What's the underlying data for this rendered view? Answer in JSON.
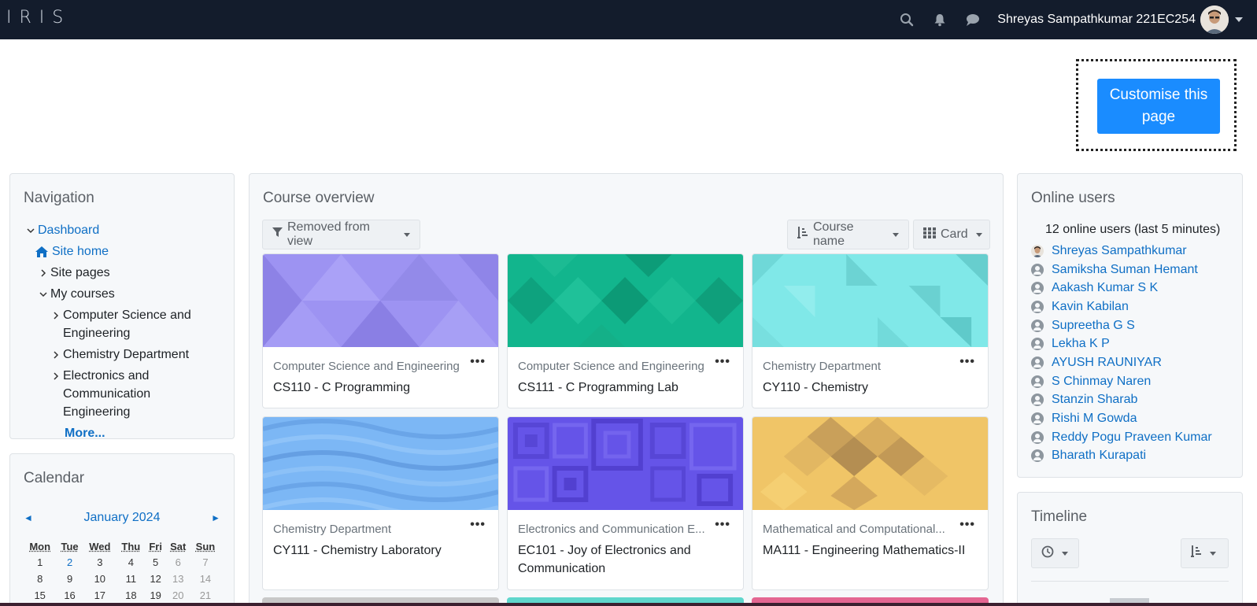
{
  "navbar": {
    "logo": "IRIS",
    "username": "Shreyas Sampathkumar 221EC254",
    "icons": [
      "search-icon",
      "bell-icon",
      "chat-icon"
    ]
  },
  "customise": {
    "label": "Customise this page"
  },
  "navigation": {
    "title": "Navigation",
    "dashboard": "Dashboard",
    "site_home": "Site home",
    "site_pages": "Site pages",
    "my_courses": "My courses",
    "courses": [
      "Computer Science and Engineering",
      "Chemistry Department",
      "Electronics and Communication Engineering"
    ],
    "more": "More..."
  },
  "calendar": {
    "title": "Calendar",
    "prev": "◄",
    "next": "►",
    "month": "January 2024",
    "days": [
      "Mon",
      "Tue",
      "Wed",
      "Thu",
      "Fri",
      "Sat",
      "Sun"
    ],
    "weeks": [
      [
        "1",
        "2",
        "3",
        "4",
        "5",
        "6",
        "7"
      ],
      [
        "8",
        "9",
        "10",
        "11",
        "12",
        "13",
        "14"
      ],
      [
        "15",
        "16",
        "17",
        "18",
        "19",
        "20",
        "21"
      ]
    ]
  },
  "overview": {
    "title": "Course overview",
    "filter": "Removed from view",
    "sort": "Course name",
    "view": "Card",
    "menu_icon": "•••",
    "courses": [
      {
        "category": "Computer Science and Engineering",
        "name": "CS110 - C Programming",
        "color": "#9b8ff0"
      },
      {
        "category": "Computer Science and Engineering",
        "name": "CS111 - C Programming Lab",
        "color": "#10b48c"
      },
      {
        "category": "Chemistry Department",
        "name": "CY110 - Chemistry",
        "color": "#7ce6e6"
      },
      {
        "category": "Chemistry Department",
        "name": "CY111 - Chemistry Laboratory",
        "color": "#79b8f5"
      },
      {
        "category": "Electronics and Communication E...",
        "name": "EC101 - Joy of Electronics and Communication",
        "color": "#6451e6"
      },
      {
        "category": "Mathematical and Computational...",
        "name": "MA111 - Engineering Mathematics-II",
        "color": "#f0c060"
      }
    ]
  },
  "online_users": {
    "title": "Online users",
    "summary": "12 online users (last 5 minutes)",
    "users": [
      "Shreyas Sampathkumar",
      "Samiksha Suman Hemant",
      "Aakash Kumar S K",
      "Kavin Kabilan",
      "Supreetha G S",
      "Lekha K P",
      "AYUSH RAUNIYAR",
      "S Chinmay Naren",
      "Stanzin Sharab",
      "Rishi M Gowda",
      "Reddy Pogu Praveen Kumar",
      "Bharath Kurapati"
    ]
  },
  "timeline": {
    "title": "Timeline"
  }
}
